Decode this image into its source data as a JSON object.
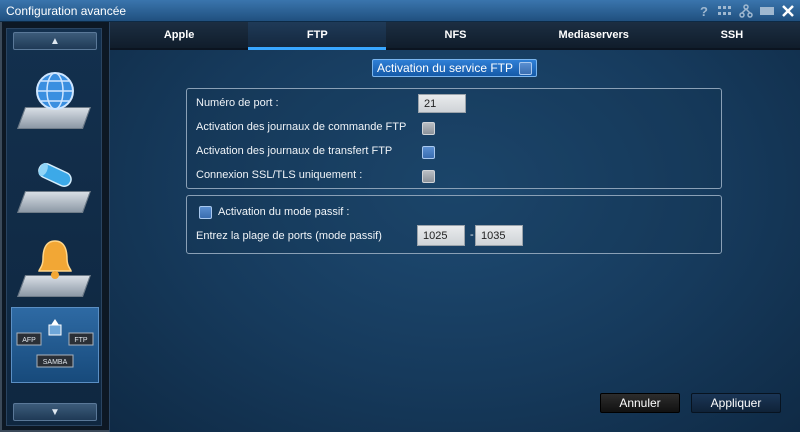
{
  "window": {
    "title": "Configuration avancée"
  },
  "titlebar_icons": [
    "help-icon",
    "keyboard-icon",
    "network-icon",
    "minimize-icon",
    "close-icon"
  ],
  "sidebar": {
    "up_label": "▲",
    "down_label": "▼",
    "items": [
      {
        "name": "network-globe",
        "icon": "globe-icon"
      },
      {
        "name": "storage",
        "icon": "disk-icon"
      },
      {
        "name": "notifications",
        "icon": "bell-icon"
      },
      {
        "name": "services",
        "icon": "services-icon",
        "labels": {
          "afp": "AFP",
          "ftp": "FTP",
          "samba": "SAMBA"
        },
        "active": true
      }
    ]
  },
  "tabs": [
    {
      "label": "Apple",
      "active": false
    },
    {
      "label": "FTP",
      "active": true
    },
    {
      "label": "NFS",
      "active": false
    },
    {
      "label": "Mediaservers",
      "active": false
    },
    {
      "label": "SSH",
      "active": false
    }
  ],
  "service_toggle": {
    "label": "Activation du service FTP",
    "checked": false
  },
  "ftp_settings": {
    "port_label": "Numéro de port :",
    "port_value": "21",
    "cmd_log_label": "Activation des journaux de commande FTP",
    "cmd_log_checked": false,
    "transfer_log_label": "Activation des journaux de transfert FTP",
    "transfer_log_checked": false,
    "ssl_label": "Connexion SSL/TLS uniquement :",
    "ssl_checked": false
  },
  "passive": {
    "label": "Activation du mode passif :",
    "checked": false,
    "range_label": "Entrez la plage de ports (mode passif)",
    "start": "1025",
    "separator": "-",
    "end": "1035"
  },
  "buttons": {
    "cancel": "Annuler",
    "apply": "Appliquer"
  },
  "colors": {
    "accent": "#39a7ff",
    "service_bg": "#2f7fd6"
  }
}
